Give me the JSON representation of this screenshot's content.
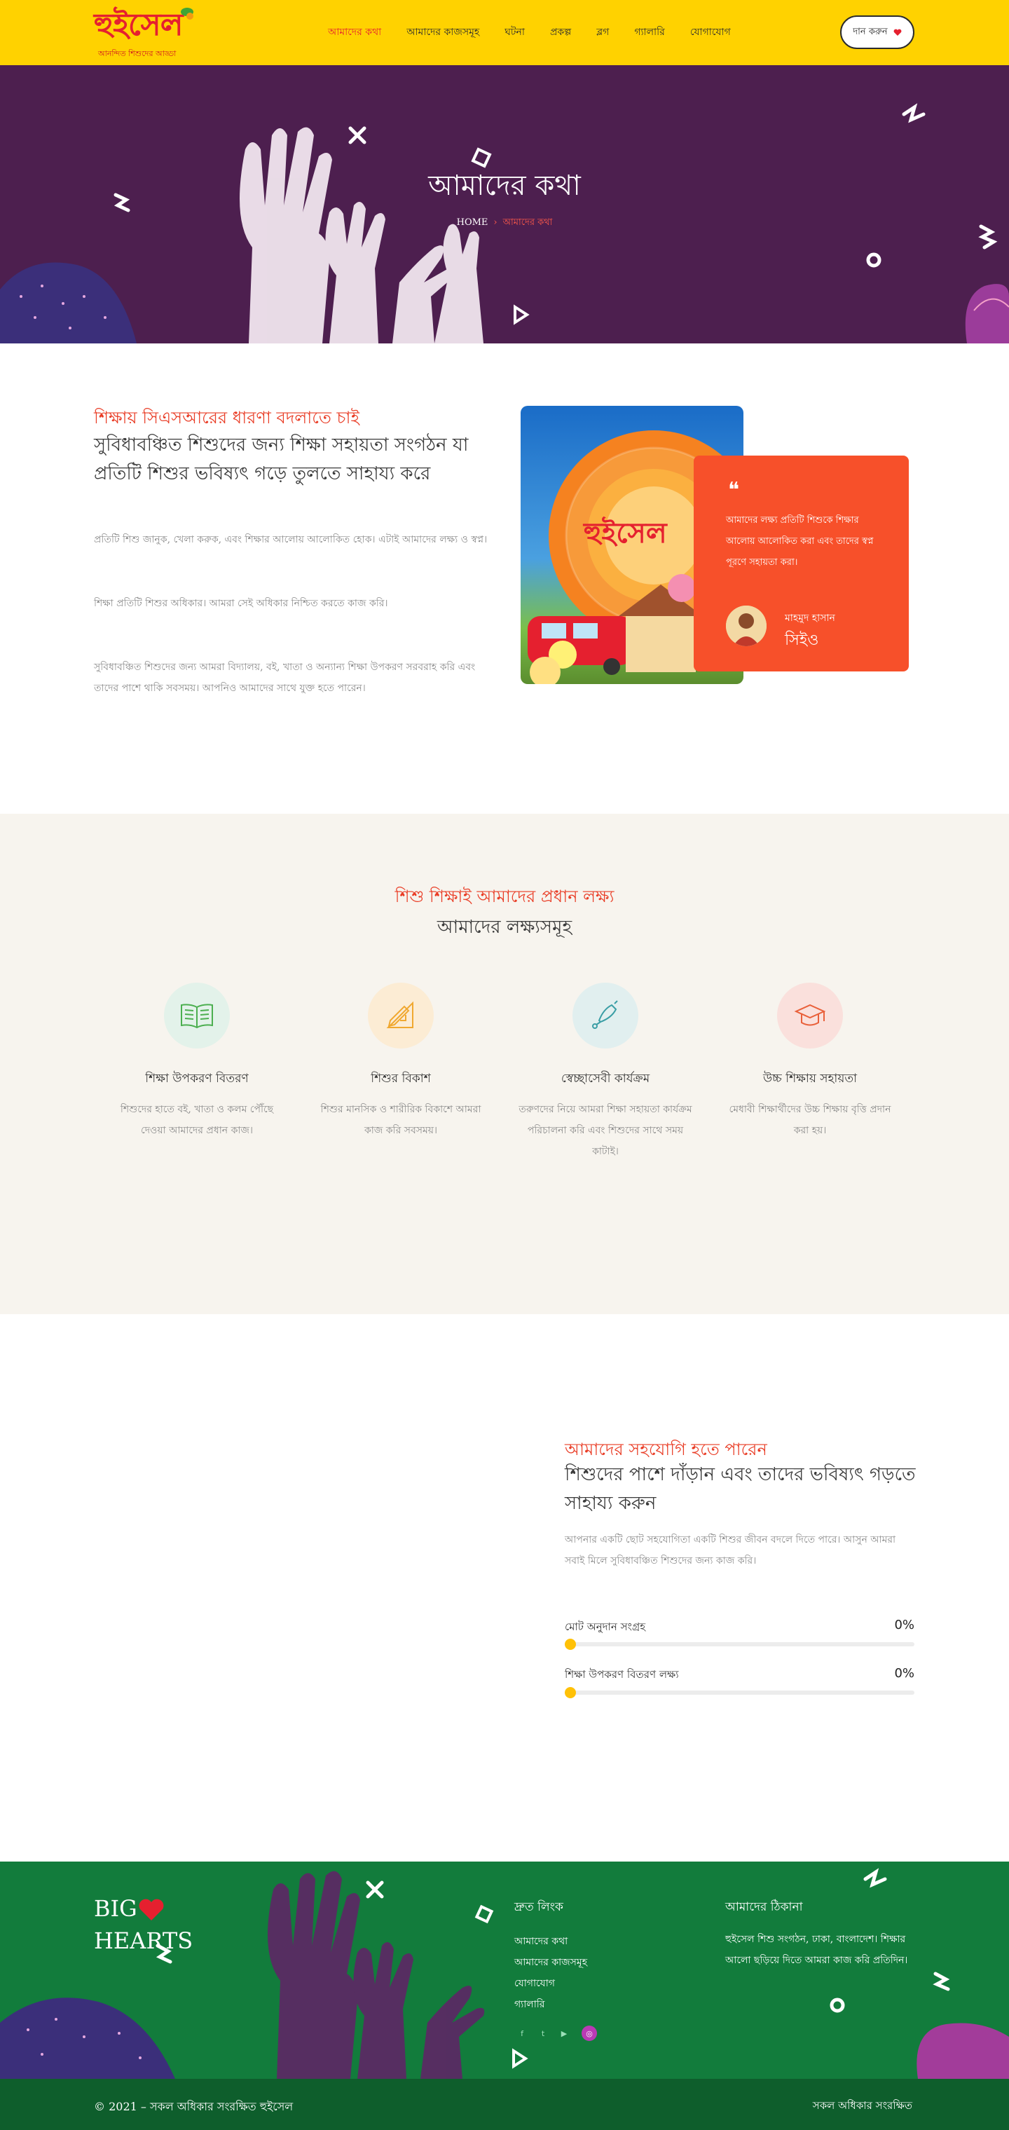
{
  "brand": {
    "logo_text": "হুইসেল",
    "tagline": "আনন্দিত শিশুদের আড্ডা"
  },
  "nav": {
    "items": [
      "আমাদের কথা",
      "আমাদের কাজসমূহ",
      "ঘটনা",
      "প্রকল্প",
      "ব্লগ",
      "গ্যালারি",
      "যোগাযোগ"
    ],
    "active_index": 0
  },
  "header": {
    "donate_label": "দান করুন"
  },
  "hero": {
    "title": "আমাদের কথা",
    "breadcrumb_home": "HOME",
    "breadcrumb_separator": "›",
    "breadcrumb_current": "আমাদের কথা"
  },
  "about": {
    "subtitle": "শিক্ষায় সিএসআরের ধারণা বদলাতে চাই",
    "title": "সুবিধাবঞ্চিত শিশুদের জন্য শিক্ষা সহায়তা সংগঠন যা প্রতিটি শিশুর ভবিষ্যৎ গড়ে তুলতে সাহায্য করে",
    "paragraphs": [
      "প্রতিটি শিশু জানুক, খেলা করুক, এবং শিক্ষার আলোয় আলোকিত হোক। এটাই আমাদের লক্ষ্য ও স্বপ্ন।",
      "শিক্ষা প্রতিটি শিশুর অধিকার। আমরা সেই অধিকার নিশ্চিত করতে কাজ করি।",
      "সুবিধাবঞ্চিত শিশুদের জন্য আমরা বিদ্যালয়, বই, খাতা ও অন্যান্য শিক্ষা উপকরণ সরবরাহ করি এবং তাদের পাশে থাকি সবসময়। আপনিও আমাদের সাথে যুক্ত হতে পারেন।"
    ]
  },
  "quote": {
    "icon": "quote-icon",
    "text": "আমাদের লক্ষ্য প্রতিটি শিশুকে শিক্ষার আলোয় আলোকিত করা এবং তাদের স্বপ্ন পূরণে সহায়তা করা।",
    "name": "মাহমুদ হাসান",
    "role": "সিইও"
  },
  "mission": {
    "subtitle": "শিশু শিক্ষাই আমাদের প্রধান লক্ষ্য",
    "title": "আমাদের লক্ষ্যসমূহ",
    "features": [
      {
        "title": "শিক্ষা উপকরণ বিতরণ",
        "text": "শিশুদের হাতে বই, খাতা ও কলম পৌঁছে দেওয়া আমাদের প্রধান কাজ।",
        "icon": "book-icon",
        "color": "#e3f2ea"
      },
      {
        "title": "শিশুর বিকাশ",
        "text": "শিশুর মানসিক ও শারীরিক বিকাশে আমরা কাজ করি সবসময়।",
        "icon": "ruler-pencil-icon",
        "color": "#fcecd4"
      },
      {
        "title": "স্বেচ্ছাসেবী কার্যক্রম",
        "text": "তরুণদের নিয়ে আমরা শিক্ষা সহায়তা কার্যক্রম পরিচালনা করি এবং শিশুদের সাথে সময় কাটাই।",
        "icon": "bell-icon",
        "color": "#e1efef"
      },
      {
        "title": "উচ্চ শিক্ষায় সহায়তা",
        "text": "মেধাবী শিক্ষার্থীদের উচ্চ শিক্ষায় বৃত্তি প্রদান করা হয়।",
        "icon": "graduation-cap-icon",
        "color": "#fae0dc"
      }
    ]
  },
  "support": {
    "subtitle": "আমাদের সহযোগি হতে পারেন",
    "title": "শিশুদের পাশে দাঁড়ান এবং তাদের ভবিষ্যৎ গড়তে সাহায্য করুন",
    "paragraph": "আপনার একটি ছোট সহযোগিতা একটি শিশুর জীবন বদলে দিতে পারে। আসুন আমরা সবাই মিলে সুবিধাবঞ্চিত শিশুদের জন্য কাজ করি।",
    "progress": [
      {
        "label": "মোট অনুদান সংগ্রহ",
        "percent": 0,
        "display": "0%"
      },
      {
        "label": "শিক্ষা উপকরণ বিতরণ লক্ষ্য",
        "percent": 0,
        "display": "0%"
      }
    ]
  },
  "footer": {
    "brand_line1": "BIG",
    "brand_line2": "HEARTS",
    "links_heading": "দ্রুত লিংক",
    "links": [
      "আমাদের কথা",
      "আমাদের কাজসমূহ",
      "যোগাযোগ",
      "গ্যালারি"
    ],
    "contact_heading": "আমাদের ঠিকানা",
    "contact_text": "হুইসেল শিশু সংগঠন, ঢাকা, বাংলাদেশ। শিক্ষার আলো ছড়িয়ে দিতে আমরা কাজ করি প্রতিদিন।",
    "social_icons": [
      "facebook-icon",
      "twitter-icon",
      "youtube-icon",
      "instagram-icon"
    ],
    "copyright": "© 2021 – সকল অধিকার সংরক্ষিত হুইসেল",
    "right_text": "সকল অধিকার সংরক্ষিত"
  }
}
